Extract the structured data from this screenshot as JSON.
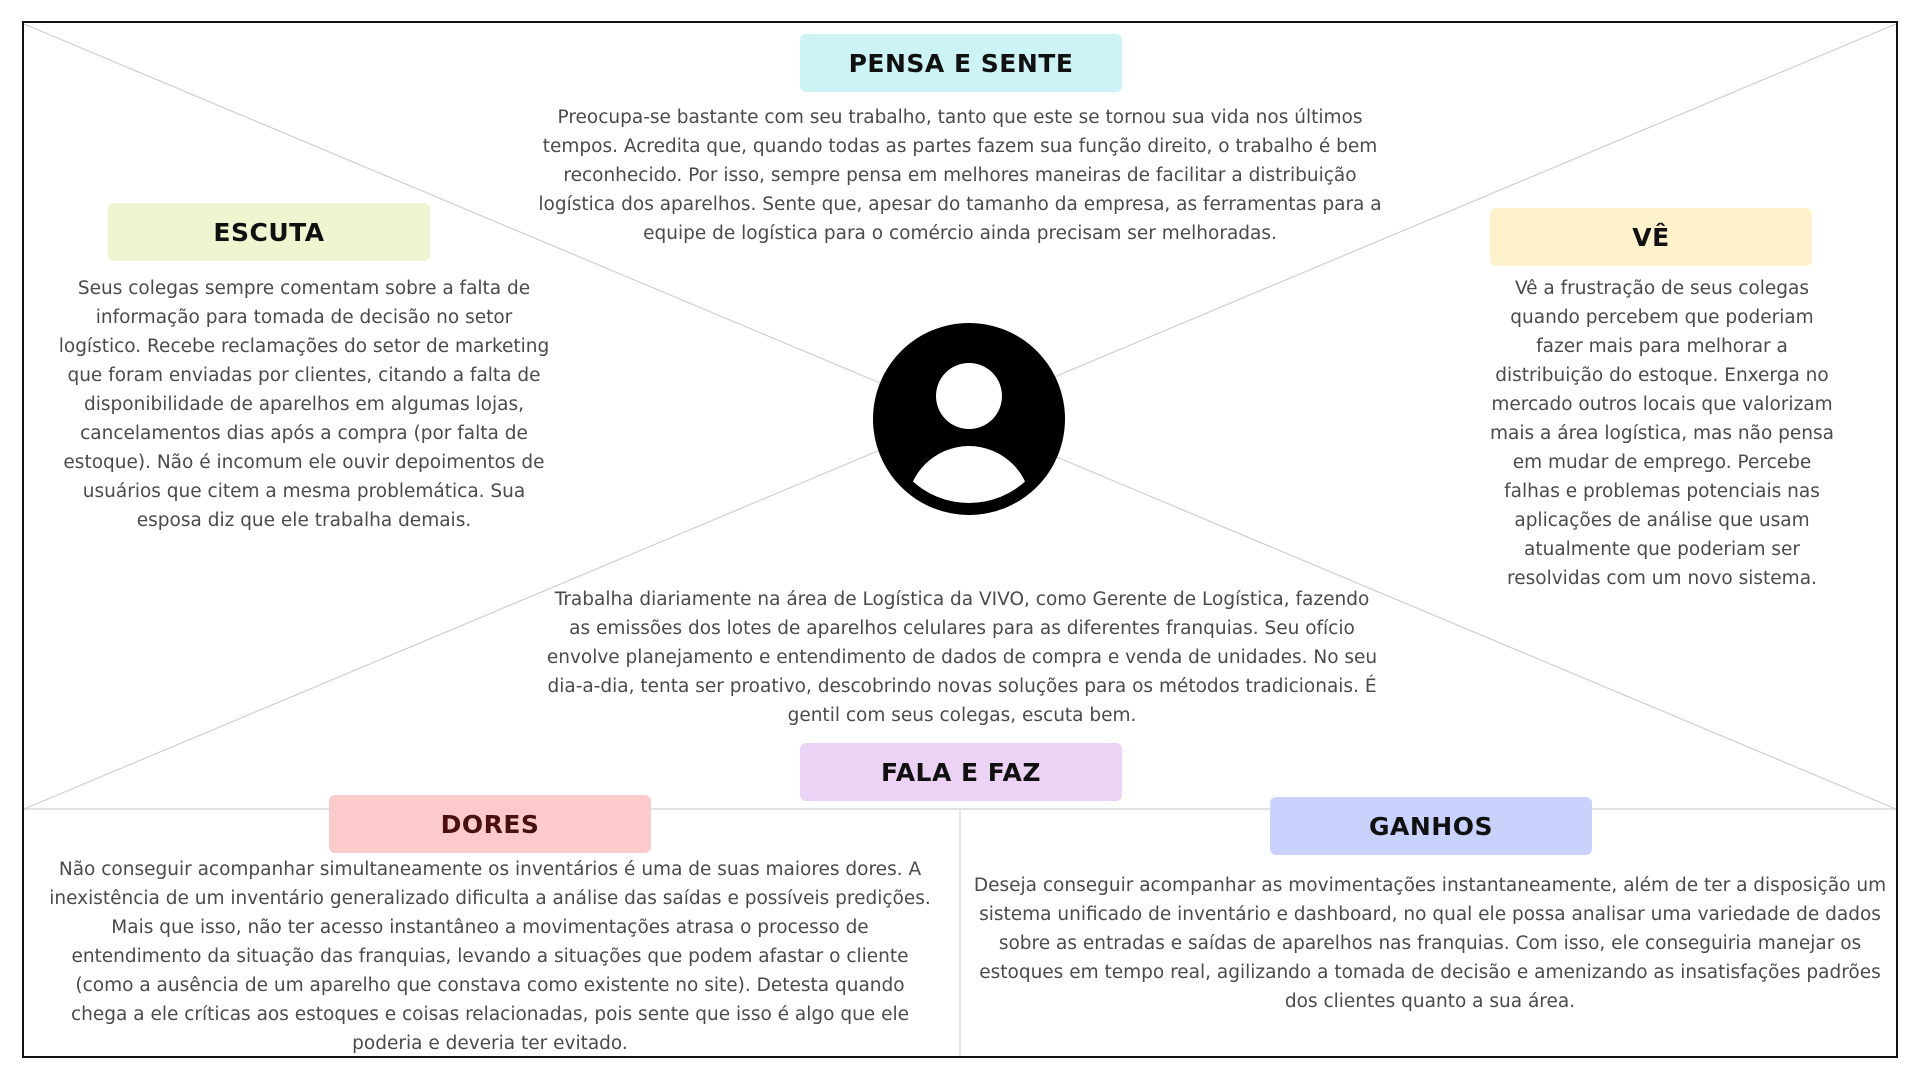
{
  "colors": {
    "pensa": "#cdf3f5",
    "escuta": "#eef5d0",
    "ve": "#fdf2cc",
    "fala": "#ecd3f5",
    "dores": "#fccaca",
    "ganhos": "#c9d1fd"
  },
  "pensa": {
    "title": "PENSA E SENTE",
    "lines": [
      "Preocupa-se bastante com seu trabalho, tanto que este se tornou sua vida nos últimos",
      "tempos. Acredita que, quando todas as partes fazem sua função direito, o trabalho é bem",
      "reconhecido. Por isso, sempre pensa em melhores maneiras de facilitar a distribuição",
      "logística dos aparelhos. Sente que, apesar do tamanho da empresa, as ferramentas para a",
      "equipe de logística para o comércio ainda precisam ser melhoradas."
    ]
  },
  "escuta": {
    "title": "ESCUTA",
    "lines": [
      "Seus colegas sempre comentam sobre a falta de",
      "informação para tomada de decisão no setor",
      "logístico. Recebe reclamações do setor de marketing",
      "que foram enviadas por clientes, citando a falta de",
      "disponibilidade de aparelhos em algumas lojas,",
      "cancelamentos dias após a compra (por falta de",
      "estoque). Não é incomum ele ouvir depoimentos de",
      "usuários que citem a mesma problemática. Sua",
      "esposa diz que ele trabalha demais."
    ]
  },
  "ve": {
    "title": "VÊ",
    "lines": [
      "Vê a frustração de seus colegas",
      "quando percebem que poderiam",
      "fazer mais para melhorar a",
      "distribuição do estoque. Enxerga no",
      "mercado outros locais que valorizam",
      "mais a área logística, mas não pensa",
      "em mudar de emprego. Percebe",
      "falhas e problemas potenciais nas",
      "aplicações de análise que usam",
      "atualmente que poderiam ser",
      "resolvidas com um novo sistema."
    ]
  },
  "fala": {
    "title": "FALA E FAZ",
    "lines": [
      "Trabalha diariamente na área de Logística da VIVO, como Gerente de Logística, fazendo",
      "as emissões dos lotes de aparelhos celulares para as diferentes franquias. Seu ofício",
      "envolve planejamento e entendimento de dados de compra e venda de unidades. No seu",
      "dia-a-dia, tenta ser proativo, descobrindo novas soluções para os métodos tradicionais. É",
      "gentil com seus colegas, escuta bem."
    ]
  },
  "dores": {
    "title": "DORES",
    "lines": [
      "Não conseguir acompanhar simultaneamente os inventários é uma de suas maiores dores. A",
      "inexistência de um inventário generalizado dificulta a análise das saídas e possíveis predições.",
      "Mais que isso, não ter acesso instantâneo a movimentações atrasa o processo de",
      "entendimento da situação das franquias, levando a situações que podem afastar o cliente",
      "(como a ausência de um aparelho que constava como existente no site). Detesta quando",
      "chega a ele críticas aos estoques e coisas relacionadas, pois sente que isso é algo que ele",
      "poderia e deveria ter evitado."
    ]
  },
  "ganhos": {
    "title": "GANHOS",
    "lines": [
      "Deseja conseguir acompanhar as movimentações instantaneamente, além de ter a disposição um",
      "sistema unificado de inventário e dashboard, no qual ele possa analisar uma variedade de dados",
      "sobre as entradas e saídas de aparelhos nas franquias. Com isso, ele conseguiria manejar os",
      "estoques em tempo real, agilizando a tomada de decisão e amenizando as insatisfações padrões",
      "dos clientes quanto a sua área."
    ]
  }
}
